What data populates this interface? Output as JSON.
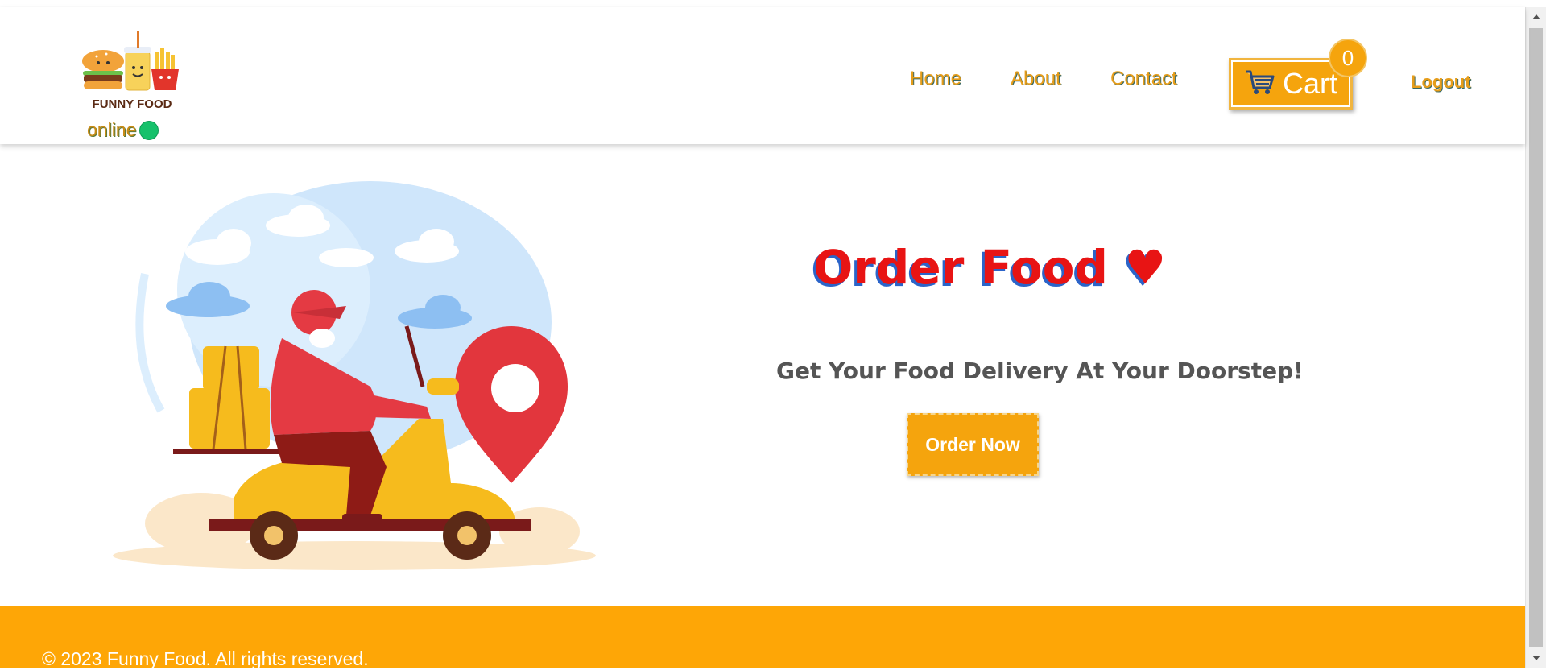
{
  "header": {
    "logo_text": "FUNNY FOOD",
    "status": "online",
    "status_color": "#16c16b",
    "nav": [
      {
        "label": "Home"
      },
      {
        "label": "About"
      },
      {
        "label": "Contact"
      }
    ],
    "cart": {
      "label": "Cart",
      "count": "0",
      "icon": "cart-icon"
    },
    "logout_label": "Logout"
  },
  "hero": {
    "title": "Order Food ♥",
    "subtitle": "Get Your Food Delivery At Your Doorstep!",
    "cta_label": "Order Now",
    "illustration": "delivery-scooter-illustration"
  },
  "footer": {
    "copyright": "© 2023 Funny Food. All rights reserved."
  },
  "colors": {
    "accent": "#f5a40d",
    "title_red": "#e81414",
    "footer_bg": "#fea606"
  }
}
